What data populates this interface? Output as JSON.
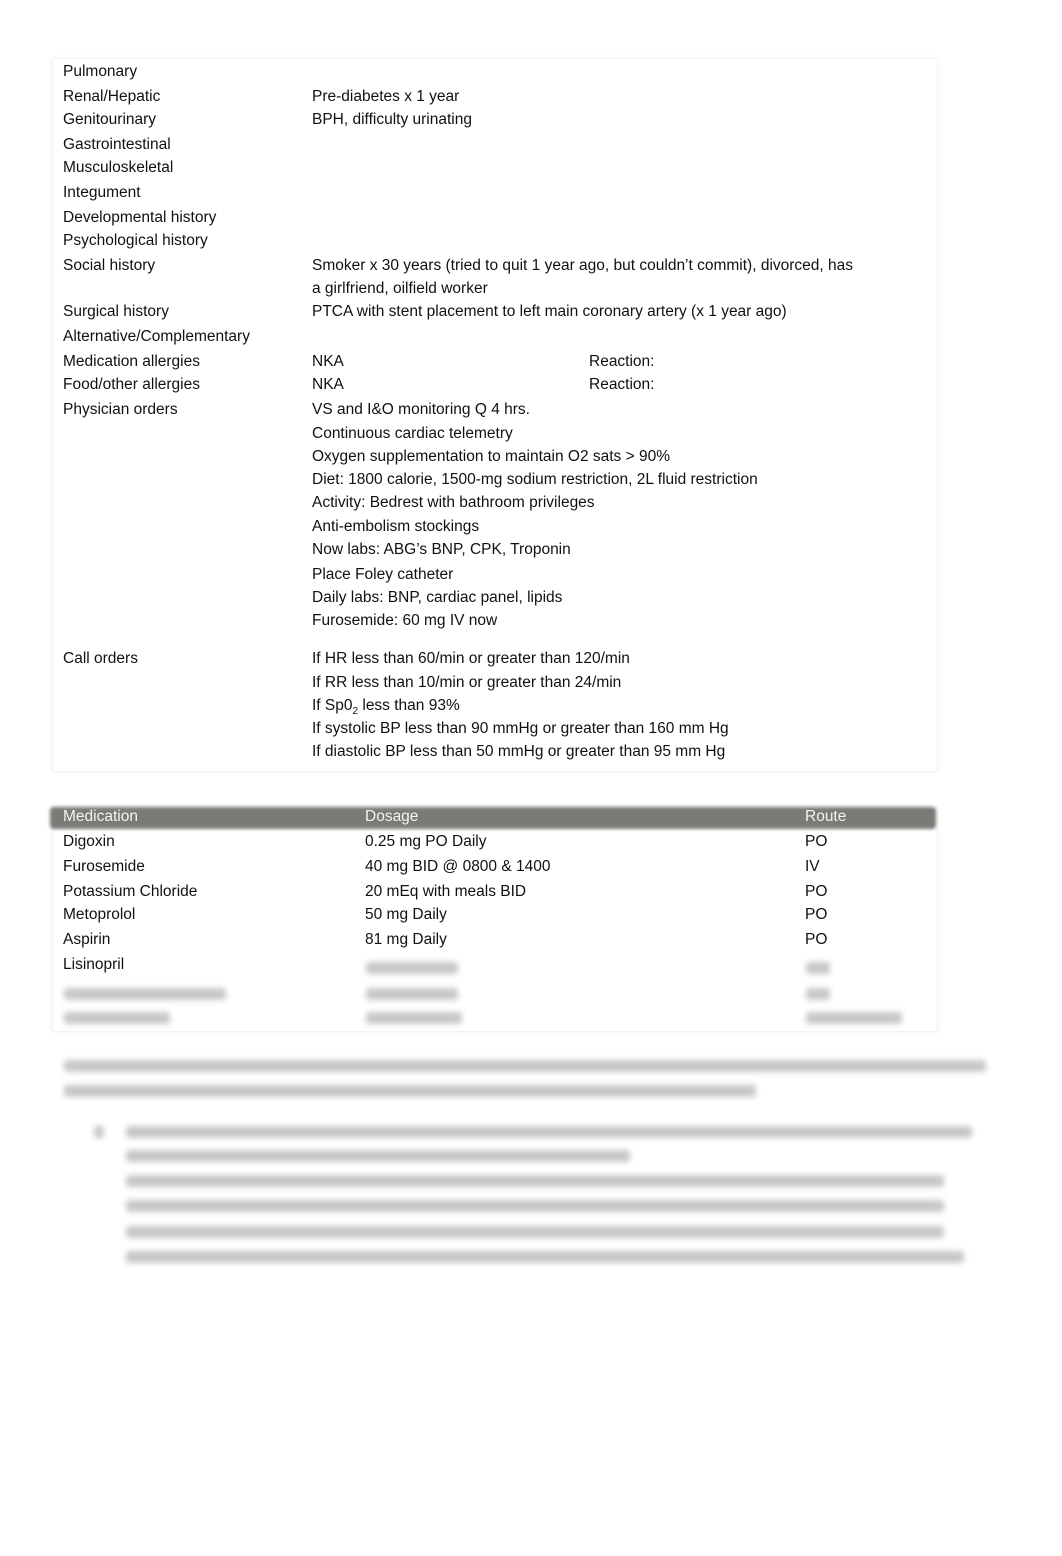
{
  "history": [
    {
      "label": "Pulmonary",
      "value": ""
    },
    {
      "label": "Renal/Hepatic",
      "value": "Pre-diabetes x 1 year"
    },
    {
      "label": "Genitourinary",
      "value": "BPH, difficulty urinating"
    },
    {
      "label": "Gastrointestinal",
      "value": ""
    },
    {
      "label": "Musculoskeletal",
      "value": ""
    },
    {
      "label": "Integument",
      "value": ""
    },
    {
      "label": "Developmental history",
      "value": ""
    },
    {
      "label": "Psychological history",
      "value": ""
    },
    {
      "label": "Social history",
      "value": "Smoker x 30 years (tried to quit 1 year ago, but couldn’t commit), divorced, has",
      "value2": "a girlfriend, oilfield worker"
    },
    {
      "label": "Surgical history",
      "value": "PTCA with stent placement to left main coronary artery (x 1 year ago)"
    },
    {
      "label": "Alternative/Complementary",
      "value": ""
    }
  ],
  "allergies": [
    {
      "label": "Medication allergies",
      "value": "NKA",
      "reaction_label": "Reaction:"
    },
    {
      "label": "Food/other allergies",
      "value": "NKA",
      "reaction_label": "Reaction:"
    }
  ],
  "physician_orders": {
    "label": "Physician orders",
    "items": [
      "VS and I&O monitoring Q 4 hrs.",
      "Continuous cardiac telemetry",
      "Oxygen supplementation to maintain O2 sats > 90%",
      "Diet: 1800 calorie, 1500-mg sodium restriction, 2L fluid restriction",
      "Activity: Bedrest with bathroom privileges",
      "Anti-embolism stockings",
      "Now labs: ABG’s BNP, CPK, Troponin",
      "Place Foley catheter",
      "Daily labs: BNP, cardiac panel, lipids",
      "Furosemide: 60 mg IV now"
    ]
  },
  "call_orders": {
    "label": "Call orders",
    "items": [
      "If HR less than 60/min or greater than 120/min",
      "If RR less than 10/min or greater than 24/min",
      {
        "prefix": "If Sp0",
        "sub": "2",
        "suffix": " less than 93%"
      },
      "If systolic BP less than 90 mmHg or greater than 160 mm Hg",
      "If diastolic BP less than 50 mmHg or greater than 95 mm Hg"
    ]
  },
  "medications": {
    "headers": [
      "Medication",
      "Dosage",
      "Route"
    ],
    "rows": [
      [
        "Digoxin",
        "0.25 mg PO Daily",
        "PO"
      ],
      [
        "Furosemide",
        "40 mg BID @ 0800 & 1400",
        "IV"
      ],
      [
        "Potassium Chloride",
        "20 mEq with meals BID",
        "PO"
      ],
      [
        "Metoprolol",
        "50 mg Daily",
        "PO"
      ],
      [
        "Aspirin",
        "81 mg Daily",
        "PO"
      ],
      [
        "Lisinopril",
        "",
        ""
      ]
    ]
  }
}
